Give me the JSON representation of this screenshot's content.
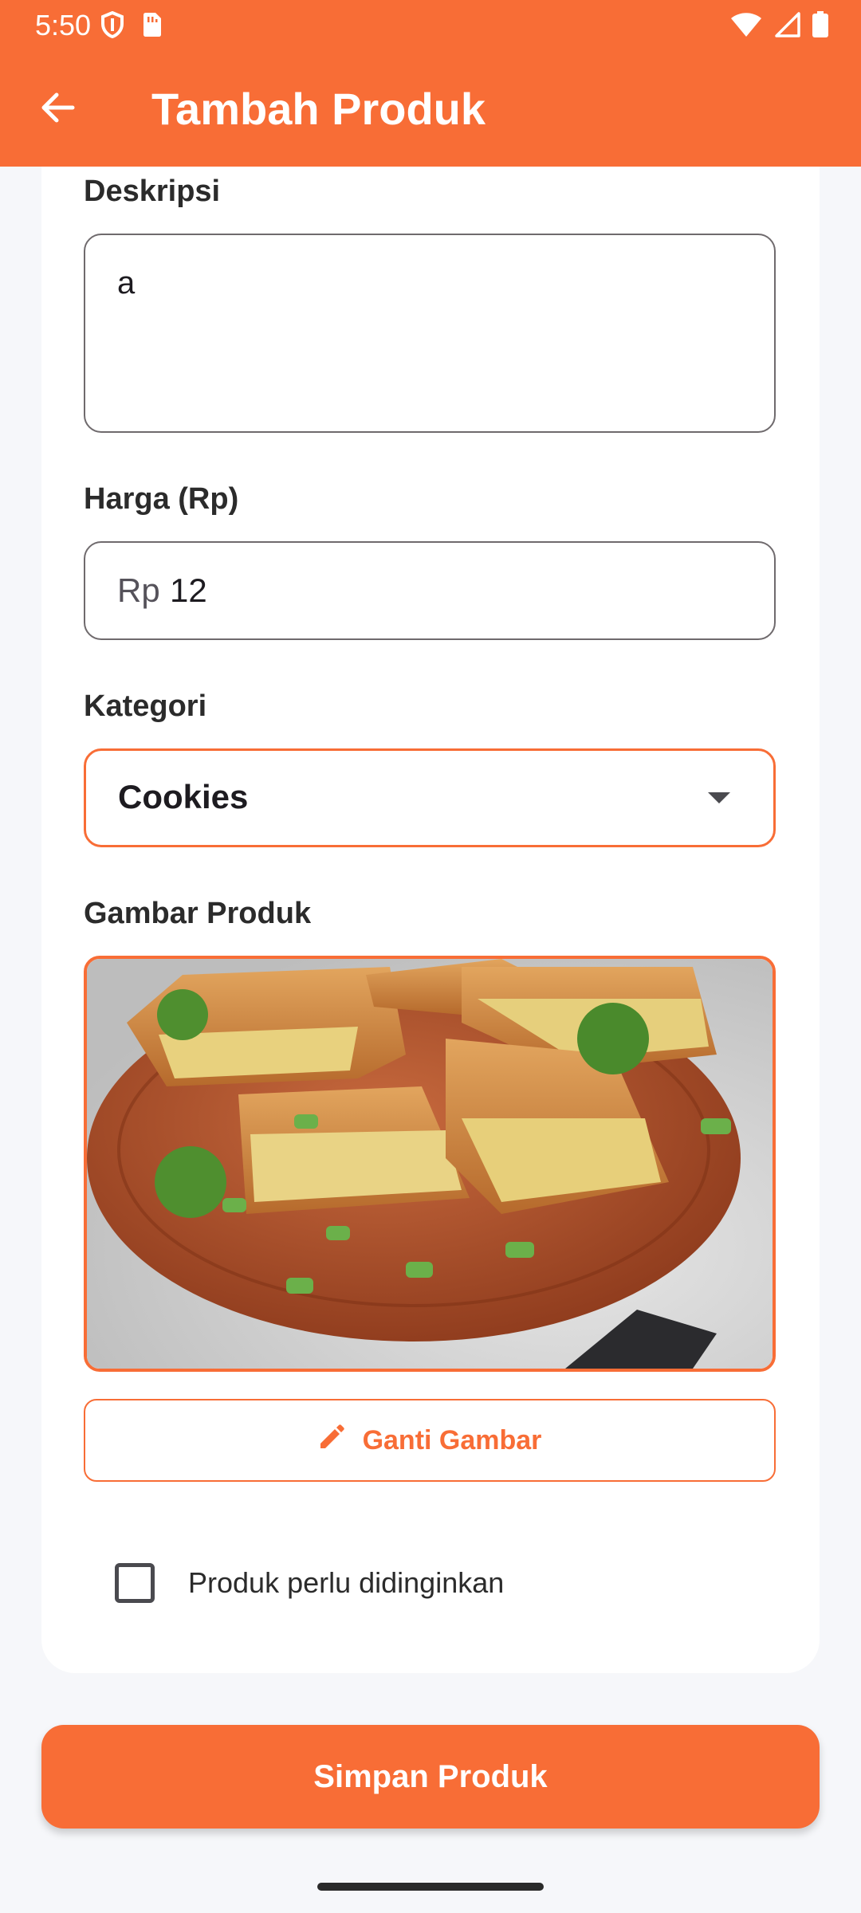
{
  "status_bar": {
    "time": "5:50",
    "left_icons": [
      "shield-icon",
      "sim-card-icon"
    ],
    "right_icons": [
      "wifi-icon",
      "cellular-signal-icon",
      "battery-icon"
    ]
  },
  "app_bar": {
    "title": "Tambah Produk",
    "back_icon": "arrow-left-icon"
  },
  "form": {
    "description": {
      "label": "Deskripsi",
      "value": "a"
    },
    "price": {
      "label": "Harga (Rp)",
      "prefix": "Rp",
      "value": "12"
    },
    "category": {
      "label": "Kategori",
      "selected": "Cookies",
      "icon": "dropdown-arrow-icon"
    },
    "image": {
      "label": "Gambar Produk",
      "change_label": "Ganti Gambar",
      "change_icon": "pencil-icon"
    },
    "chilled": {
      "label": "Produk perlu didinginkan",
      "checked": false
    }
  },
  "actions": {
    "save_label": "Simpan Produk"
  },
  "colors": {
    "primary": "#f86d36",
    "background": "#f6f7fa",
    "card": "#ffffff",
    "outline": "#6f6a6d"
  }
}
